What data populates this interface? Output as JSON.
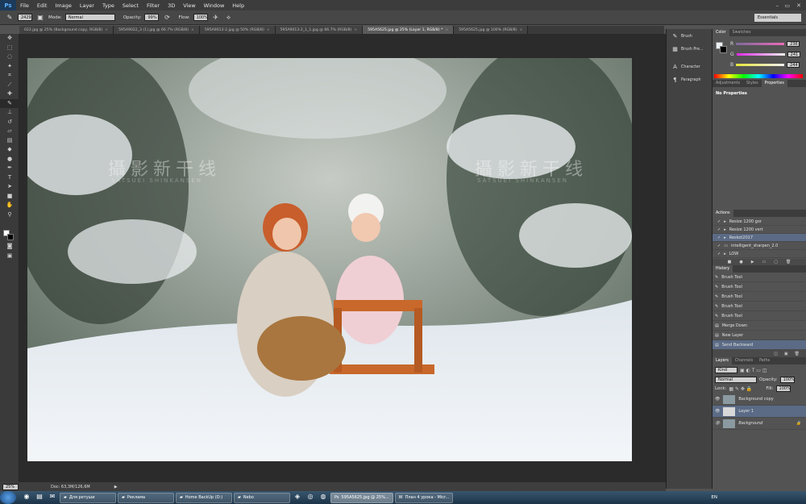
{
  "app": {
    "logo": "Ps"
  },
  "menu": [
    "File",
    "Edit",
    "Image",
    "Layer",
    "Type",
    "Select",
    "Filter",
    "3D",
    "View",
    "Window",
    "Help"
  ],
  "window_controls": [
    "–",
    "▭",
    "✕"
  ],
  "options": {
    "brush_size": "2429",
    "mode_label": "Mode:",
    "mode_value": "Normal",
    "opacity_label": "Opacity:",
    "opacity_value": "99%",
    "flow_label": "Flow:",
    "flow_value": "100%",
    "workspace": "Essentials"
  },
  "tabs": [
    {
      "label": "022.jpg @ 25% (Background copy, RGB/8)",
      "active": false
    },
    {
      "label": "595A9022_3 (1).jpg @ 66.7% (RGB/8)",
      "active": false
    },
    {
      "label": "595A9013-2.jpg @ 50% (RGB/8)",
      "active": false
    },
    {
      "label": "595A9013-2_1_1.jpg @ 66.7% (RGB/8)",
      "active": false
    },
    {
      "label": "595A5625.jpg @ 25% (Layer 1, RGB/8) *",
      "active": true
    },
    {
      "label": "595A5625.jpg @ 100% (RGB/8)",
      "active": false
    }
  ],
  "photo": {
    "watermark_cn": "攝影新干线",
    "watermark_en": "SATSUEI SHINKANSEN"
  },
  "panel_icons": [
    {
      "icon": "brush-icon",
      "glyph": "✎",
      "label": "Brush"
    },
    {
      "icon": "brush-presets-icon",
      "glyph": "▦",
      "label": "Brush Pre..."
    },
    {
      "icon": "character-icon",
      "glyph": "A",
      "label": "Character"
    },
    {
      "icon": "paragraph-icon",
      "glyph": "¶",
      "label": "Paragraph"
    }
  ],
  "color_panel": {
    "tabs": [
      "Color",
      "Swatches"
    ],
    "sliders": [
      {
        "name": "R",
        "value": "236",
        "color": "#e0407a"
      },
      {
        "name": "G",
        "value": "241",
        "color": "#50d070"
      },
      {
        "name": "B",
        "value": "244",
        "color": "#5080e0"
      }
    ]
  },
  "adjustments_panel": {
    "tabs": [
      "Adjustments",
      "Styles",
      "Properties"
    ],
    "message": "No Properties"
  },
  "actions_panel": {
    "title": "Actions",
    "items": [
      "Resize 1200 gor",
      "Resize 1200 vert",
      "Reskot2017",
      "intelligent_sharpen_2.0",
      "LOW"
    ]
  },
  "history_panel": {
    "title": "History",
    "items": [
      "Brush Tool",
      "Brush Tool",
      "Brush Tool",
      "Brush Tool",
      "Brush Tool",
      "Merge Down",
      "New Layer",
      "Send Backward"
    ]
  },
  "layers_panel": {
    "tabs": [
      "Layers",
      "Channels",
      "Paths"
    ],
    "kind": "Kind",
    "blend": "Normal",
    "opacity_label": "Opacity:",
    "opacity": "100%",
    "lock_label": "Lock:",
    "fill_label": "Fill:",
    "fill": "100%",
    "layers": [
      "Background copy",
      "Layer 1",
      "Background"
    ]
  },
  "status": {
    "zoom": "25%",
    "doc": "Doc: 63,3M/126,6M"
  },
  "taskbar": {
    "buttons": [
      "Для ретуши",
      "Реклама",
      "Home BackUp (D:)",
      "Nebo",
      "595A5625.jpg @ 25%...",
      "План 4 урока - Micr..."
    ],
    "lang": "EN"
  }
}
